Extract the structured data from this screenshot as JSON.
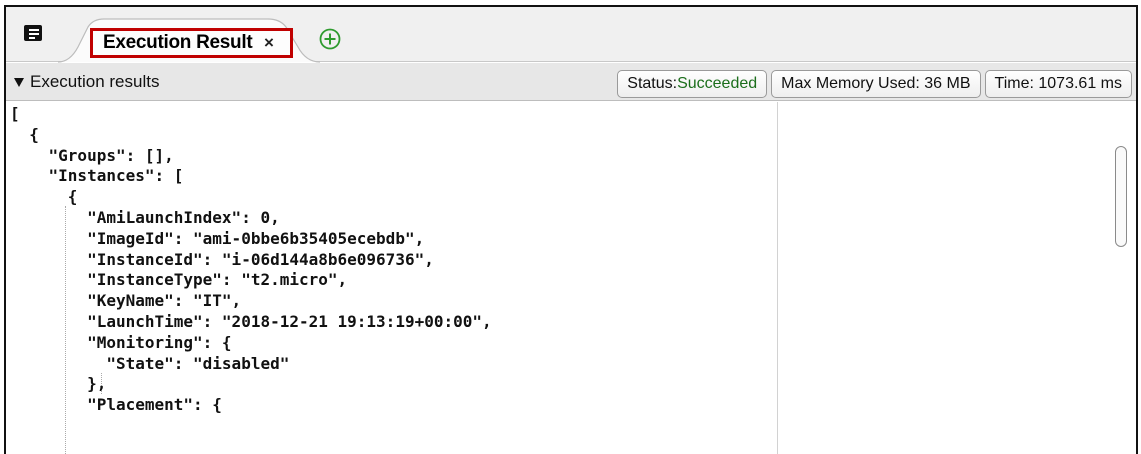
{
  "tabbar": {
    "menu_icon": "panel-menu-icon",
    "active_tab": {
      "label": "Execution Result",
      "close_glyph": "×"
    },
    "add_tab_icon": "plus-circle-icon",
    "accent_color": "#c00000",
    "add_color": "#2e9b2e"
  },
  "results": {
    "title": "Execution results",
    "status_label": "Status: ",
    "status_value": "Succeeded",
    "memory": "Max Memory Used: 36 MB",
    "time": "Time: 1073.61 ms",
    "status_color": "#1b6e1b"
  },
  "code": {
    "lines": [
      "[",
      "  {",
      "    \"Groups\": [],",
      "    \"Instances\": [",
      "      {",
      "        \"AmiLaunchIndex\": 0,",
      "        \"ImageId\": \"ami-0bbe6b35405ecebdb\",",
      "        \"InstanceId\": \"i-06d144a8b6e096736\",",
      "        \"InstanceType\": \"t2.micro\",",
      "        \"KeyName\": \"IT\",",
      "        \"LaunchTime\": \"2018-12-21 19:13:19+00:00\",",
      "        \"Monitoring\": {",
      "          \"State\": \"disabled\"",
      "        },",
      "        \"Placement\": {"
    ]
  }
}
